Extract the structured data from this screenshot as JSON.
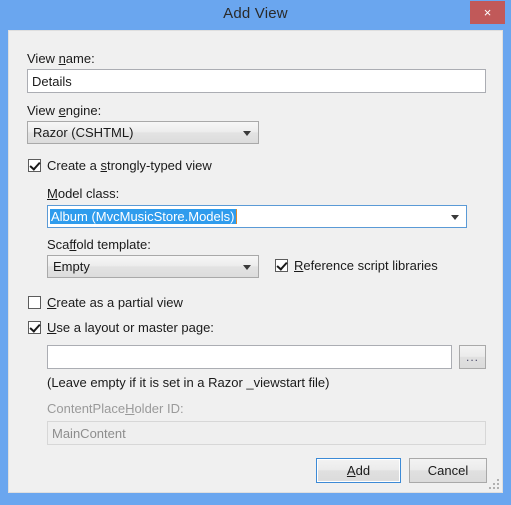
{
  "window": {
    "title": "Add View",
    "close_label": "×"
  },
  "fields": {
    "view_name_label_pre": "View ",
    "view_name_label_mnem": "n",
    "view_name_label_post": "ame:",
    "view_name_label_full": "View name:",
    "view_name_value": "Details",
    "view_engine_label_pre": "View ",
    "view_engine_label_mnem": "e",
    "view_engine_label_post": "ngine:",
    "view_engine_label_full": "View engine:",
    "view_engine_value": "Razor (CSHTML)",
    "model_class_label_mnem": "M",
    "model_class_label_post": "odel class:",
    "model_class_label_full": "Model class:",
    "model_class_value": "Album (MvcMusicStore.Models)",
    "scaffold_label_pre": "Sca",
    "scaffold_label_mnem": "ff",
    "scaffold_label_post": "old template:",
    "scaffold_label_full": "Scaffold template:",
    "scaffold_value": "Empty",
    "layout_path_value": "",
    "layout_hint": "(Leave empty if it is set in a Razor _viewstart file)",
    "placeholder_label_pre": "ContentPlace",
    "placeholder_label_mnem": "H",
    "placeholder_label_post": "older ID:",
    "placeholder_label_full": "ContentPlaceHolder ID:",
    "placeholder_value": "MainContent"
  },
  "checkboxes": {
    "strongly_typed": {
      "pre": "Create a ",
      "mnem": "s",
      "post": "trongly-typed view",
      "full": "Create a strongly-typed view",
      "checked": true
    },
    "reference_scripts": {
      "pre": "",
      "mnem": "R",
      "post": "eference script libraries",
      "full": "Reference script libraries",
      "checked": true
    },
    "partial_view": {
      "pre": "",
      "mnem": "C",
      "post": "reate as a partial view",
      "full": "Create as a partial view",
      "checked": false
    },
    "use_layout": {
      "pre": "",
      "mnem": "U",
      "post": "se a layout or master page:",
      "full": "Use a layout or master page:",
      "checked": true
    }
  },
  "buttons": {
    "browse": "...",
    "add_mnem": "A",
    "add_post": "dd",
    "add_full": "Add",
    "cancel": "Cancel"
  },
  "colors": {
    "titlebar": "#6aa6ef",
    "close": "#c15959",
    "dialog_bg": "#f0f0f0",
    "selection": "#2f9ced",
    "focus_border": "#3c8ad6"
  }
}
